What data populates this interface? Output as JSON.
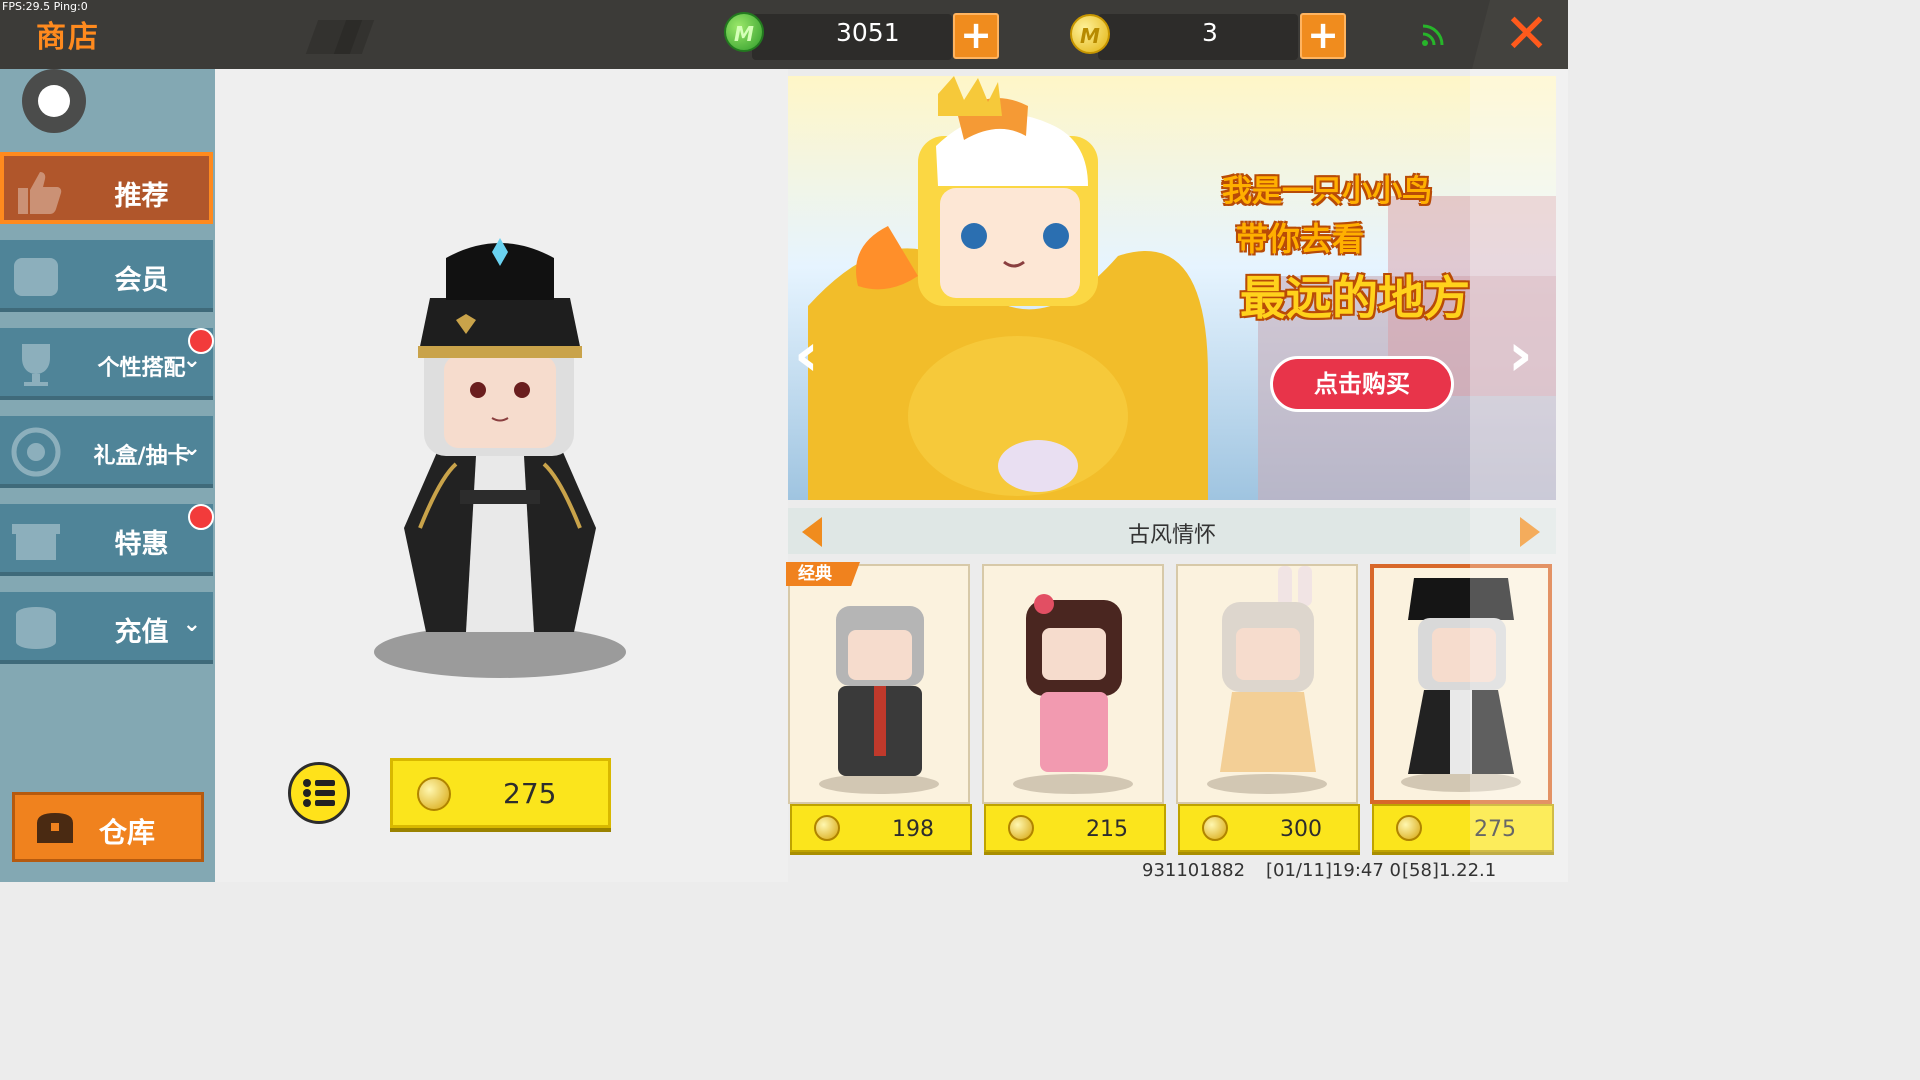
{
  "debug": {
    "fps_text": "FPS:29.5 Ping:0"
  },
  "topbar": {
    "title": "商店",
    "gems": "3051",
    "coins": "3",
    "gem_icon_label": "M",
    "coin_icon_label": "M",
    "plus": "+",
    "close": "✕"
  },
  "sidebar": {
    "items": [
      {
        "label": "推荐"
      },
      {
        "label": "会员"
      },
      {
        "label": "个性搭配"
      },
      {
        "label": "礼盒/抽卡"
      },
      {
        "label": "特惠"
      },
      {
        "label": "充值"
      }
    ],
    "chevron": "⌄",
    "warehouse": "仓库"
  },
  "preview": {
    "price": "275"
  },
  "banner": {
    "line1": "我是一只小小鸟",
    "line2": "带你去看",
    "line3": "最远的地方",
    "buy": "点击购买"
  },
  "set": {
    "title": "古风情怀",
    "badge": "经典"
  },
  "cards": [
    {
      "price": "198"
    },
    {
      "price": "215"
    },
    {
      "price": "300"
    },
    {
      "price": "275"
    }
  ],
  "footer": {
    "uid": "931101882",
    "time": "[01/11]19:47 0",
    "version": "[58]1.22.1"
  },
  "colors": {
    "accent": "#f0821e",
    "sidebar": "#4f8498",
    "price_yellow": "#fbe51c",
    "close": "#ff5a1c"
  }
}
